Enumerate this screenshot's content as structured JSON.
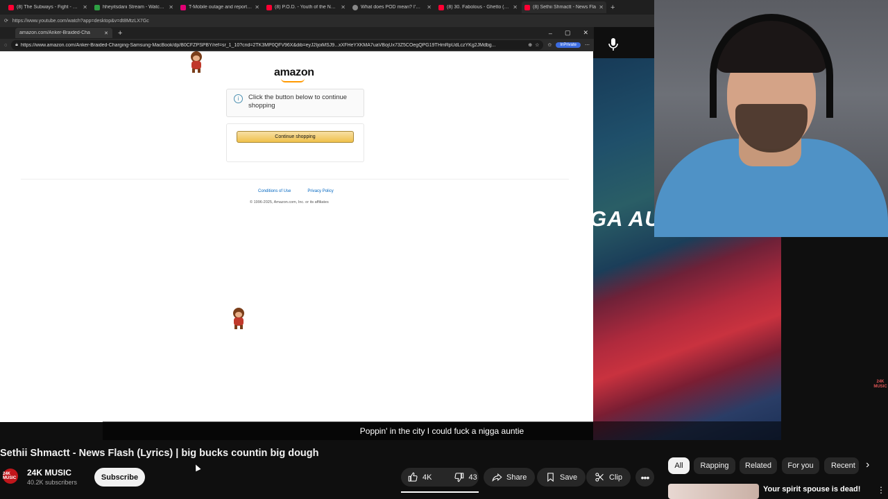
{
  "outer_browser": {
    "tabs": [
      {
        "label": "(8) The Subways - Fight - Official",
        "color": "#ff0033"
      },
      {
        "label": "hheyitsdani Stream - Watch Live",
        "color": "#2ea043"
      },
      {
        "label": "T-Mobile outage and reported pr",
        "color": "#e20074"
      },
      {
        "label": "(8) P.O.D. - Youth of the Nation (O",
        "color": "#ff0033"
      },
      {
        "label": "What does POD mean? I'm talking",
        "color": "#888888"
      },
      {
        "label": "(8) 30. Fabolous - Ghetto (Feat. Th",
        "color": "#ff0033"
      },
      {
        "label": "(8) Sethii Shmactt - News Fla",
        "color": "#ff0033"
      }
    ],
    "url": "https://www.youtube.com/watch?app=desktop&v=dt8MtzLX7Gc"
  },
  "inner_browser": {
    "tab_title": "amazon.com/Anker-Braided-Cha",
    "url": "https://www.amazon.com/Anker-Braided-Charging-Samsung-MacBook/dp/B0CFZPSPBY/ref=sr_1_10?crid=2TK3MP0QFV96X&dib=eyJ2IjoiMSJ9...xXFHeYXKMA7uaVBojUx73Z5COegQPG19THmRpUdLczYKg2JMdbg...",
    "inprivate_label": "InPrivate"
  },
  "amazon": {
    "logo": "amazon",
    "message": "Click the button below to continue shopping",
    "continue_button": "Continue shopping",
    "conditions_link": "Conditions of Use",
    "privacy_link": "Privacy Policy",
    "copyright": "© 1996-2025, Amazon.com, Inc. or its affiliates"
  },
  "video": {
    "lyric_overlay": "GA AU",
    "caption": "Poppin' in the city I could fuck a nigga auntie",
    "watermark": "24K MUSIC",
    "title": "Sethii Shmactt - News Flash (Lyrics) | big bucks countin big dough",
    "channel_name": "24K MUSIC",
    "avatar_text": "24K MUSIC",
    "subscribers": "40.2K subscribers",
    "subscribe_label": "Subscribe",
    "likes": "4K",
    "dislikes": "43",
    "share_label": "Share",
    "save_label": "Save",
    "clip_label": "Clip"
  },
  "chips": [
    "All",
    "Rapping",
    "Related",
    "For you",
    "Recent"
  ],
  "recommendation": {
    "title": "Your spirit spouse is dead!"
  }
}
